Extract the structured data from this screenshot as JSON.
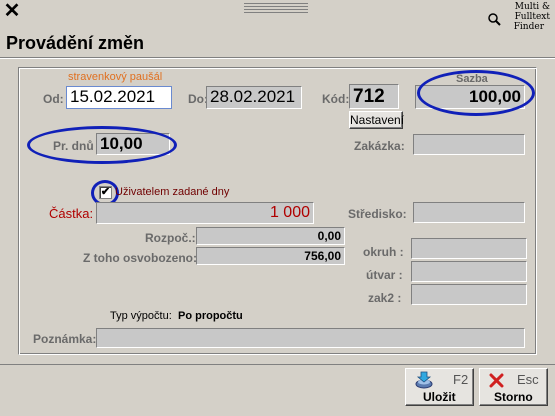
{
  "window": {
    "close_glyph": "✕",
    "multifinder_line1": "Multi & Fulltext",
    "multifinder_line2": "Finder",
    "multifinder_icon": "magnifier-icon"
  },
  "page_title": "Provádění změn",
  "form": {
    "stravenkovy_label": "stravenkový paušál",
    "od_label": "Od:",
    "od_value": "15.02.2021",
    "do_label": "Do:",
    "do_value": "28.02.2021",
    "kod_label": "Kód:",
    "kod_value": "712",
    "sazba_label": "Sazba",
    "sazba_value": "100,00",
    "nastaveni_label": "Nastavení",
    "pr_dnu_label": "Pr. dnů",
    "pr_dnu_value": "10,00",
    "zakazka_label": "Zakázka:",
    "zakazka_value": "",
    "checkbox_label": "Uživatelem zadané dny",
    "checkbox_checked": true,
    "checkbox_mark": "✔",
    "castka_label": "Částka:",
    "castka_value": "1 000",
    "stredisko_label": "Středisko:",
    "stredisko_value": "",
    "rozpoc_label": "Rozpoč.:",
    "rozpoc_value": "0,00",
    "osvobozeno_label": "Z toho osvobozeno:",
    "osvobozeno_value": "756,00",
    "okruh_label": "okruh :",
    "okruh_value": "",
    "utvar_label": "útvar :",
    "utvar_value": "",
    "zak2_label": "zak2 :",
    "zak2_value": "",
    "typ_vypoctu_label": "Typ výpočtu:",
    "typ_vypoctu_value": "Po propočtu",
    "poznamka_label": "Poznámka:",
    "poznamka_value": ""
  },
  "buttons": {
    "ulozit_label": "Uložit",
    "ulozit_key": "F2",
    "ulozit_icon": "save-download-icon",
    "storno_label": "Storno",
    "storno_key": "Esc",
    "storno_icon": "cancel-x-icon"
  },
  "colors": {
    "accent_red": "#b00000",
    "annotation_blue": "#1020b8",
    "orange_label": "#e07020"
  }
}
